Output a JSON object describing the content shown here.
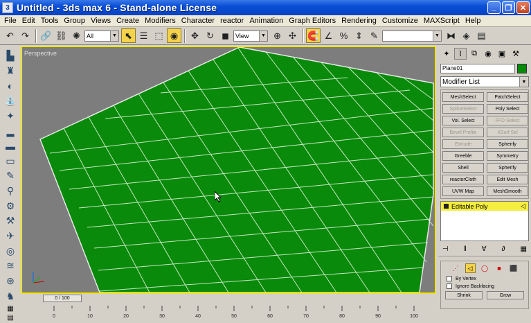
{
  "window": {
    "title": "Untitled  - 3ds max 6 - Stand-alone License",
    "app_icon": "3ds-max-logo-icon"
  },
  "menu": [
    "File",
    "Edit",
    "Tools",
    "Group",
    "Views",
    "Create",
    "Modifiers",
    "Character",
    "reactor",
    "Animation",
    "Graph Editors",
    "Rendering",
    "Customize",
    "MAXScript",
    "Help"
  ],
  "toolbar": {
    "selection_filter": "All",
    "reference_coord": "View"
  },
  "viewport": {
    "label": "Perspective",
    "plane_color": "#0a8a0a"
  },
  "command_panel": {
    "object_name": "Plane01",
    "object_color": "#078a07",
    "modifier_list": "Modifier List",
    "modifier_buttons": [
      {
        "label": "MeshSelect",
        "enabled": true
      },
      {
        "label": "PatchSelect",
        "enabled": true
      },
      {
        "label": "SplineSelect",
        "enabled": false
      },
      {
        "label": "Poly Select",
        "enabled": true
      },
      {
        "label": "Vol. Select",
        "enabled": true
      },
      {
        "label": "FFD Select",
        "enabled": false
      },
      {
        "label": "Bevel Profile",
        "enabled": false
      },
      {
        "label": "XSurf Sel",
        "enabled": false
      },
      {
        "label": "Extrude",
        "enabled": false
      },
      {
        "label": "Spherify",
        "enabled": true
      },
      {
        "label": "Greeble",
        "enabled": true
      },
      {
        "label": "Symmetry",
        "enabled": true
      },
      {
        "label": "Shell",
        "enabled": true
      },
      {
        "label": "Spherify",
        "enabled": true
      },
      {
        "label": "reactorCloth",
        "enabled": true
      },
      {
        "label": "Edit Mesh",
        "enabled": true
      },
      {
        "label": "UVW Map",
        "enabled": true
      },
      {
        "label": "MeshSmooth",
        "enabled": true
      }
    ],
    "stack": {
      "item": "Editable Poly"
    },
    "selection": {
      "by_vertex": "By Vertex",
      "ignore_backfacing": "Ignore Backfacing",
      "shrink": "Shrink",
      "grow": "Grow"
    }
  },
  "timeline": {
    "slider": "0 / 100",
    "ticks": [
      "0",
      "10",
      "20",
      "30",
      "40",
      "50",
      "60",
      "70",
      "80",
      "90",
      "100"
    ]
  }
}
